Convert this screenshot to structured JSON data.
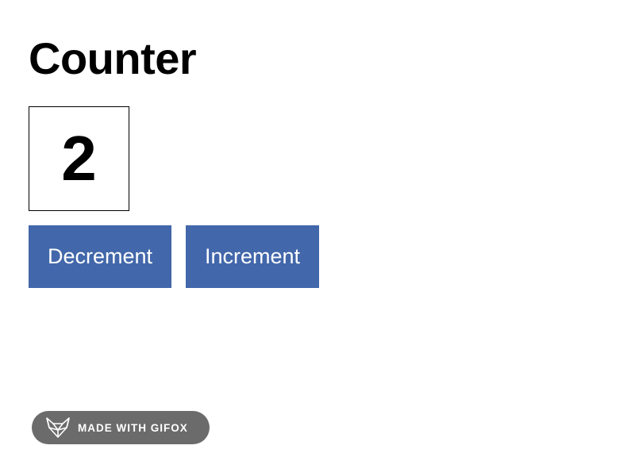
{
  "title": "Counter",
  "counter": {
    "value": "2"
  },
  "buttons": {
    "decrement_label": "Decrement",
    "increment_label": "Increment"
  },
  "badge": {
    "icon": "fox-icon",
    "text": "MADE WITH GIFOX"
  },
  "colors": {
    "button_bg": "#4267aa",
    "button_text": "#ffffff",
    "badge_bg": "#6b6b6b",
    "text": "#000000",
    "background": "#ffffff"
  }
}
